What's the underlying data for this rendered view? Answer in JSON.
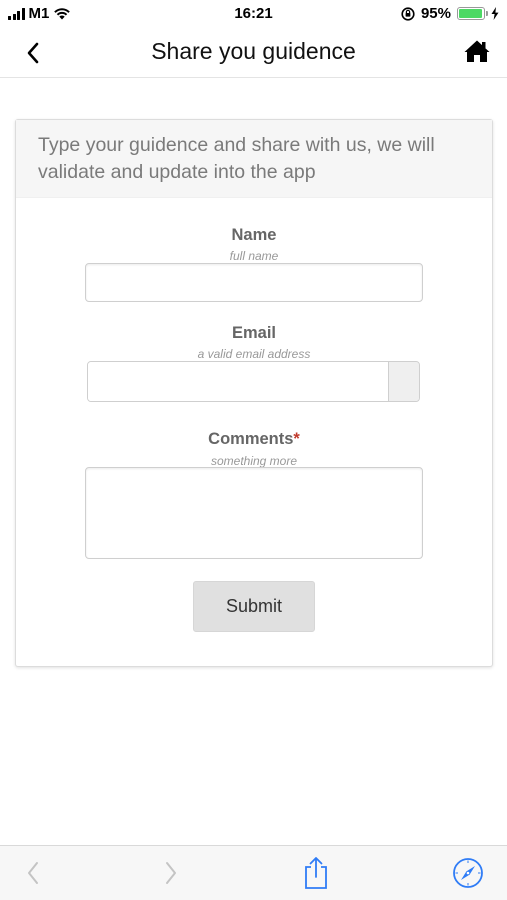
{
  "status_bar": {
    "carrier": "M1",
    "time": "16:21",
    "battery_percent": "95%",
    "battery_level": 0.95,
    "battery_color": "#4cd964"
  },
  "nav": {
    "title": "Share you guidence",
    "back_icon": "chevron-left-icon",
    "home_icon": "home-icon"
  },
  "card": {
    "intro": "Type your guidence and share with us, we will validate and update into the app"
  },
  "form": {
    "name": {
      "label": "Name",
      "hint": "full name",
      "value": ""
    },
    "email": {
      "label": "Email",
      "hint": "a valid email address",
      "value": ""
    },
    "comments": {
      "label": "Comments",
      "required_mark": "*",
      "hint": "something more",
      "value": ""
    },
    "submit_label": "Submit"
  },
  "toolbar": {
    "icons": [
      "back-arrow-icon",
      "forward-arrow-icon",
      "share-icon",
      "compass-icon"
    ],
    "accent": "#2f7cf6",
    "disabled": "#c4c4c4"
  }
}
